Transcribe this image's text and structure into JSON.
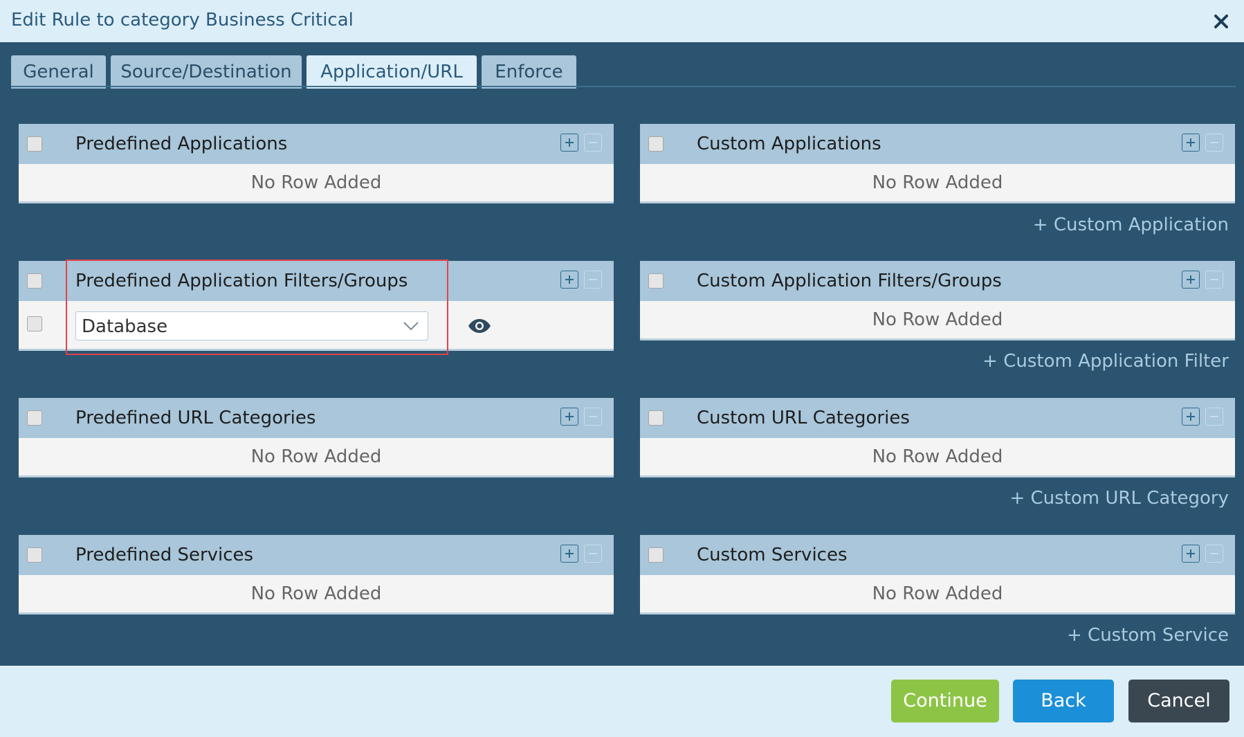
{
  "dialog": {
    "title": "Edit Rule to category Business Critical"
  },
  "tabs": [
    {
      "label": "General"
    },
    {
      "label": "Source/Destination"
    },
    {
      "label": "Application/URL"
    },
    {
      "label": "Enforce"
    }
  ],
  "active_tab": "Application/URL",
  "empty_text": "No Row Added",
  "panels": {
    "predefined_apps": {
      "title": "Predefined Applications"
    },
    "custom_apps": {
      "title": "Custom Applications",
      "link": "+ Custom Application"
    },
    "predefined_filters": {
      "title": "Predefined Application Filters/Groups",
      "row_value": "Database"
    },
    "custom_filters": {
      "title": "Custom Application Filters/Groups",
      "link": "+ Custom Application Filter"
    },
    "predefined_url": {
      "title": "Predefined URL Categories"
    },
    "custom_url": {
      "title": "Custom URL Categories",
      "link": "+ Custom URL Category"
    },
    "predefined_services": {
      "title": "Predefined Services"
    },
    "custom_services": {
      "title": "Custom Services",
      "link": "+ Custom Service"
    }
  },
  "buttons": {
    "continue": "Continue",
    "back": "Back",
    "cancel": "Cancel"
  },
  "colors": {
    "background": "#2b5470",
    "header": "#a9c6da",
    "continue": "#8dc446",
    "back": "#1b8fd8",
    "cancel": "#3a4750",
    "highlight": "#e0434a"
  }
}
